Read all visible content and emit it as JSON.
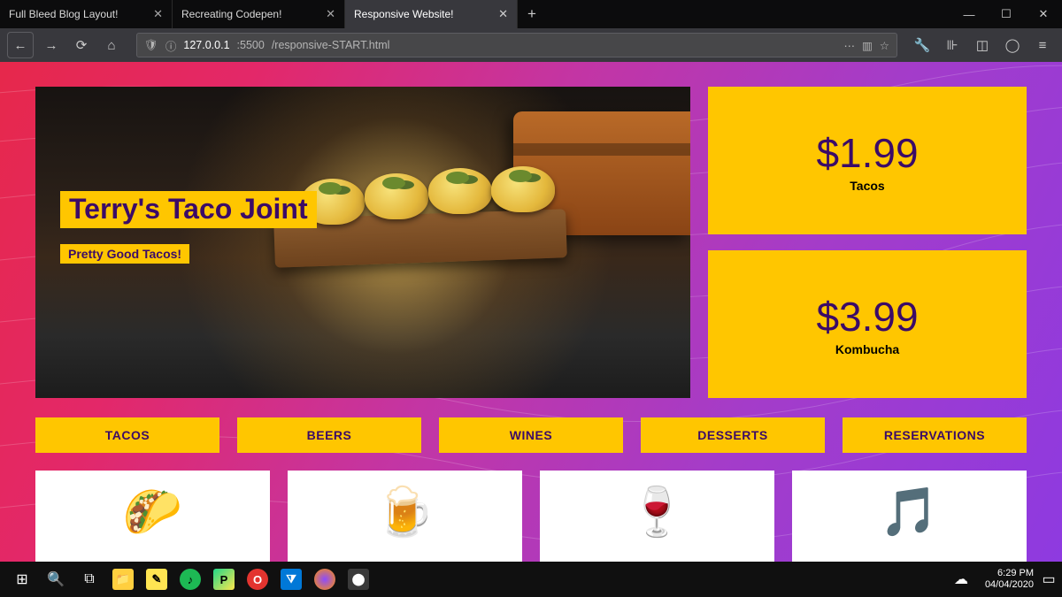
{
  "browser": {
    "tabs": [
      {
        "title": "Full Bleed Blog Layout!",
        "active": false
      },
      {
        "title": "Recreating Codepen!",
        "active": false
      },
      {
        "title": "Responsive Website!",
        "active": true
      }
    ],
    "url_host": "127.0.0.1",
    "url_port": ":5500",
    "url_path": "/responsive-START.html"
  },
  "hero": {
    "title": "Terry's Taco Joint",
    "subtitle": "Pretty Good Tacos!"
  },
  "prices": [
    {
      "price": "$1.99",
      "label": "Tacos"
    },
    {
      "price": "$3.99",
      "label": "Kombucha"
    }
  ],
  "nav": [
    "TACOS",
    "BEERS",
    "WINES",
    "DESSERTS",
    "RESERVATIONS"
  ],
  "features": [
    {
      "icon": "🌮"
    },
    {
      "icon": "🍺"
    },
    {
      "icon": "🍷"
    },
    {
      "icon": "🎵"
    }
  ],
  "taskbar": {
    "time": "6:29 PM",
    "date": "04/04/2020"
  }
}
